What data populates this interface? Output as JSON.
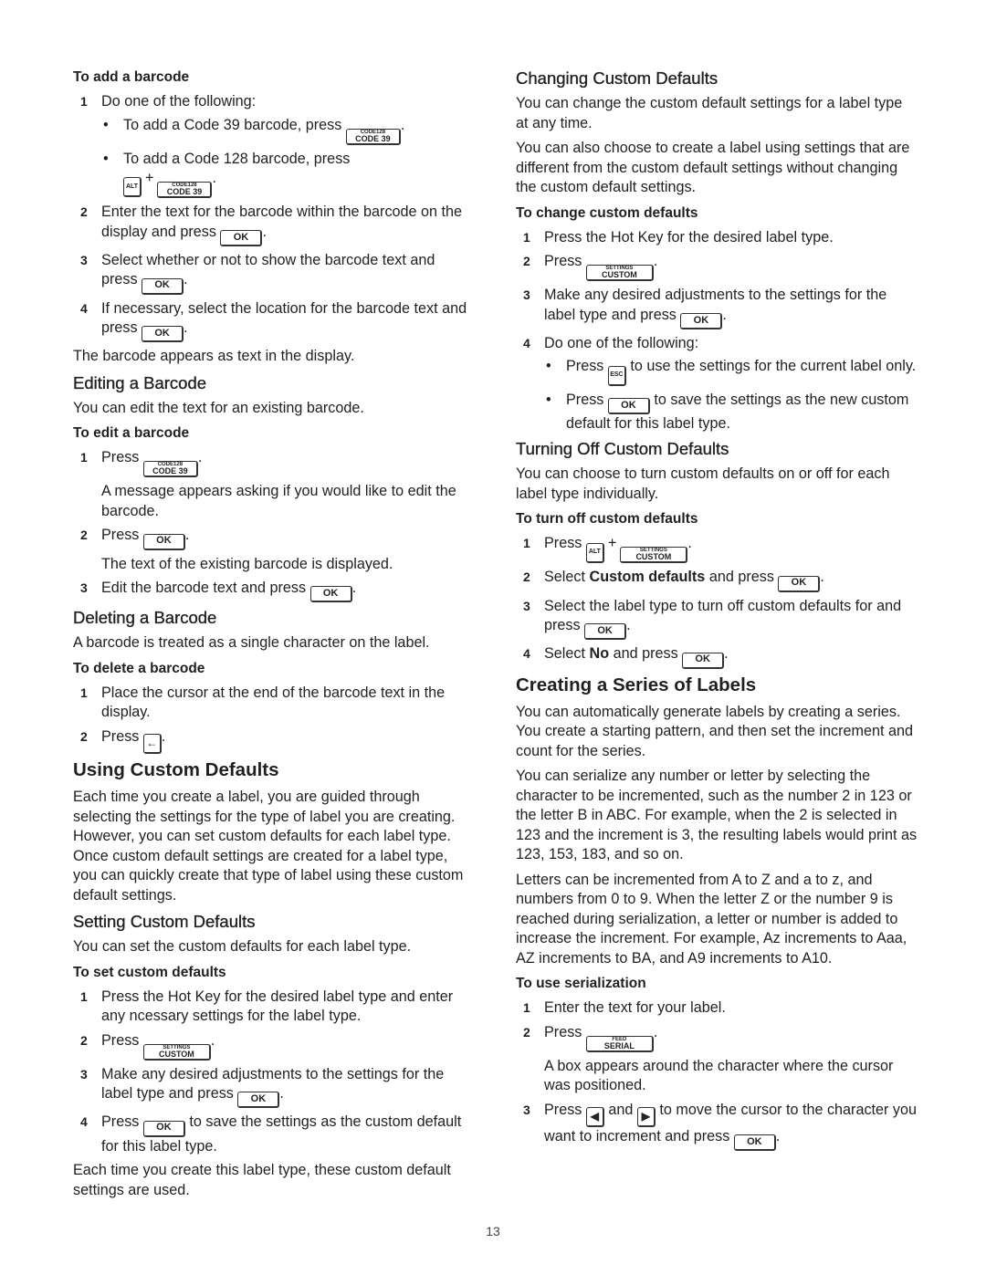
{
  "keys": {
    "code": {
      "top": "CODE128",
      "bottom": "CODE 39"
    },
    "settings": {
      "top": "SETTINGS",
      "bottom": "CUSTOM"
    },
    "serial": {
      "top": "FEED",
      "bottom": "SERIAL"
    },
    "ok": "OK",
    "alt": "ALT",
    "esc": "ESC",
    "backspace": "←",
    "left": "◀",
    "right": "▶",
    "plus": "+"
  },
  "left": {
    "add_barcode": {
      "heading": "To add a barcode",
      "step1": "Do one of the following:",
      "bullet1": "To add a Code 39 barcode, press",
      "bullet2": "To add a Code 128 barcode, press",
      "step2": "Enter the text for the barcode within the barcode on the display and press",
      "step3": "Select whether or not to show the barcode text and press",
      "step4": "If necessary, select the location for the barcode text and press",
      "result": "The barcode appears as text in the display."
    },
    "editing": {
      "heading": "Editing a Barcode",
      "intro": "You can edit the text for an existing barcode.",
      "proc": "To edit a barcode",
      "step1": "Press",
      "step1_note": "A message appears asking if you would like to edit the barcode.",
      "step2": "Press",
      "step2_note": "The text of the existing barcode is displayed.",
      "step3": "Edit the barcode text and press"
    },
    "deleting": {
      "heading": "Deleting a Barcode",
      "intro": "A barcode is treated as a single character on the label.",
      "proc": "To delete a barcode",
      "step1": "Place the cursor at the end of the barcode text in the display.",
      "step2": "Press"
    },
    "using": {
      "heading": "Using Custom Defaults",
      "body": "Each time you create a label, you are guided through selecting the settings for the type of label you are creating. However, you can set custom defaults for each label type. Once custom default settings are created for a label type, you can quickly create that type of label using these custom default settings."
    },
    "setting": {
      "heading": "Setting Custom Defaults",
      "intro": "You can set the custom defaults for each label type.",
      "proc": "To set custom defaults",
      "step1": "Press the Hot Key for the desired label type and enter any ncessary settings for the label type.",
      "step2": "Press",
      "step3": "Make any desired adjustments to the settings for the label type and press",
      "step4_pre": "Press",
      "step4_post": "to save the settings as the custom default for this label type.",
      "outro": "Each time you create this label type, these custom default settings are used."
    }
  },
  "right": {
    "changing": {
      "heading": "Changing Custom Defaults",
      "p1": "You can change the custom default settings for a label type at any time.",
      "p2": "You can also choose to create a label using settings that are different from the custom default settings without changing the custom default settings.",
      "proc": "To change custom defaults",
      "step1": "Press the Hot Key for the desired label type.",
      "step2": "Press",
      "step3": "Make any desired adjustments to the settings for the label type and press",
      "step4": "Do one of the following:",
      "bullet1_pre": "Press",
      "bullet1_post": "to use the settings for the current label only.",
      "bullet2_pre": "Press",
      "bullet2_post": "to save the settings as the new custom default for this label type."
    },
    "turning_off": {
      "heading": "Turning Off Custom Defaults",
      "intro": "You can choose to turn custom defaults on or off for each label type individually.",
      "proc": "To turn off custom defaults",
      "step1": "Press",
      "step2_pre": "Select",
      "step2_bold": "Custom defaults",
      "step2_post": "and press",
      "step3": "Select the label type to turn off custom defaults for and press",
      "step4_pre": "Select",
      "step4_bold": "No",
      "step4_post": "and press"
    },
    "series": {
      "heading": "Creating a Series of Labels",
      "p1": "You can automatically generate labels by creating a series. You create a starting pattern, and then set the increment and count for the series.",
      "p2": "You can serialize any number or letter by selecting the character to be incremented, such as the number 2 in 123 or the letter B in ABC. For example, when the 2 is selected in 123 and the increment is 3, the resulting labels would print as 123, 153, 183, and so on.",
      "p3": "Letters can be incremented from A to Z and a to z, and numbers from 0 to 9. When the letter Z or the number 9 is reached during serialization, a letter or number is added to increase the increment. For example, Az increments to Aaa, AZ increments to BA, and A9 increments to A10.",
      "proc": "To use serialization",
      "step1": "Enter the text for your label.",
      "step2": "Press",
      "step2_note": "A box appears around the character where the cursor was positioned.",
      "step3_pre": "Press",
      "step3_mid": "and",
      "step3_post": "to move the cursor to the character you want to increment and press"
    }
  },
  "footer": {
    "page_number": "13"
  }
}
